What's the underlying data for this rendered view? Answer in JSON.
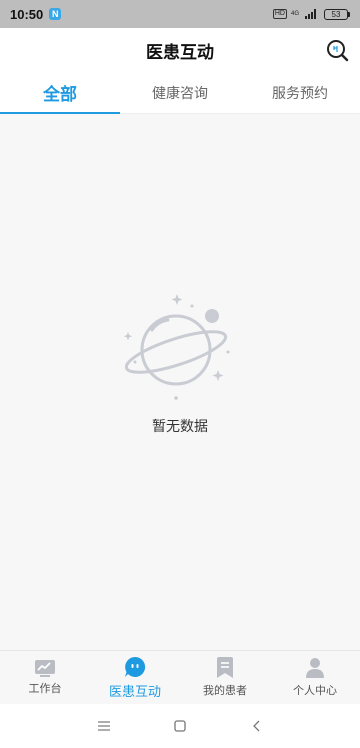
{
  "status": {
    "time": "10:50",
    "app_badge": "N",
    "hd": "HD",
    "network": "4G",
    "battery": "53"
  },
  "header": {
    "title": "医患互动"
  },
  "tabs": [
    {
      "label": "全部",
      "active": true
    },
    {
      "label": "健康咨询",
      "active": false
    },
    {
      "label": "服务预约",
      "active": false
    }
  ],
  "empty": {
    "text": "暂无数据"
  },
  "bottom_nav": [
    {
      "label": "工作台",
      "icon": "chart-icon"
    },
    {
      "label": "医患互动",
      "icon": "chat-bubble-icon",
      "active": true
    },
    {
      "label": "我的患者",
      "icon": "bookmark-icon"
    },
    {
      "label": "个人中心",
      "icon": "person-icon"
    }
  ],
  "colors": {
    "accent": "#1e9be0",
    "icon_gray": "#b9bcc2",
    "planet": "#c9ccd3"
  }
}
